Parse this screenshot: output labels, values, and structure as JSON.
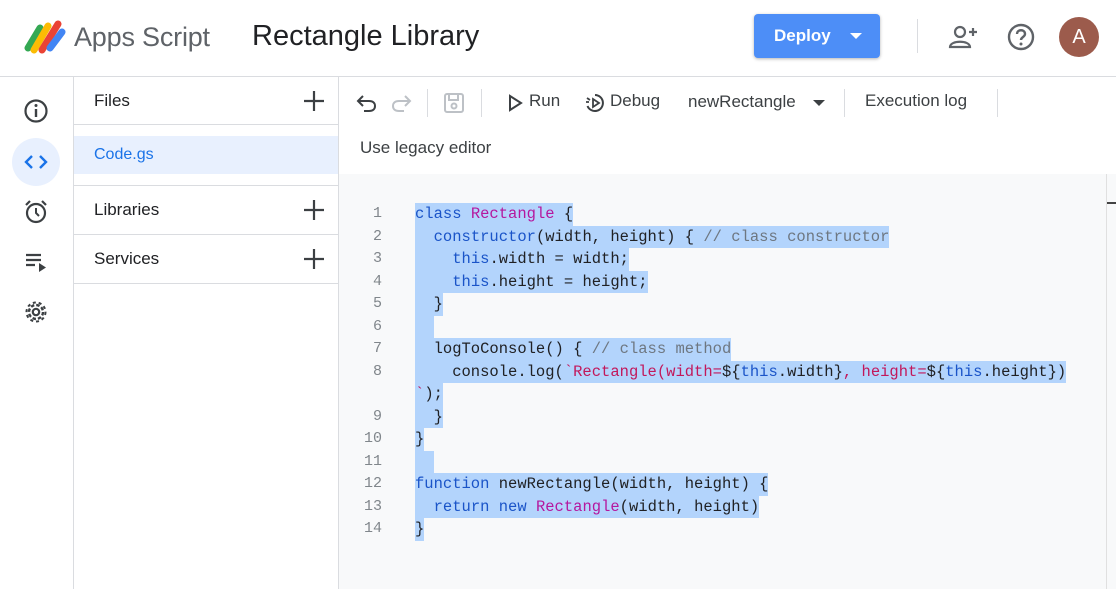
{
  "header": {
    "app_name": "Apps Script",
    "project_title": "Rectangle Library",
    "deploy_label": "Deploy",
    "avatar_initial": "A",
    "accent_color": "#4d8ef7"
  },
  "rail": {
    "items": [
      {
        "name": "overview",
        "icon": "info-icon"
      },
      {
        "name": "editor",
        "icon": "code-icon",
        "active": true
      },
      {
        "name": "triggers",
        "icon": "alarm-clock-icon"
      },
      {
        "name": "executions",
        "icon": "executions-list-icon"
      },
      {
        "name": "settings",
        "icon": "gear-icon"
      }
    ]
  },
  "files_panel": {
    "files_title": "Files",
    "files": [
      "Code.gs"
    ],
    "libraries_title": "Libraries",
    "services_title": "Services"
  },
  "toolbar": {
    "run_label": "Run",
    "debug_label": "Debug",
    "function_selected": "newRectangle",
    "execution_log_label": "Execution log",
    "legacy_label": "Use legacy editor"
  },
  "editor": {
    "line_numbers": [
      "1",
      "2",
      "3",
      "4",
      "5",
      "6",
      "7",
      "8",
      "",
      "9",
      "10",
      "11",
      "12",
      "13",
      "14"
    ],
    "lines": [
      [
        [
          "k",
          "class"
        ],
        [
          "p",
          " "
        ],
        [
          "t",
          "Rectangle"
        ],
        [
          "p",
          " {"
        ]
      ],
      [
        [
          "p",
          "  "
        ],
        [
          "k",
          "constructor"
        ],
        [
          "p",
          "(width, height) { "
        ],
        [
          "cm",
          "// class constructor"
        ]
      ],
      [
        [
          "p",
          "    "
        ],
        [
          "k",
          "this"
        ],
        [
          "p",
          ".width = width;"
        ]
      ],
      [
        [
          "p",
          "    "
        ],
        [
          "k",
          "this"
        ],
        [
          "p",
          ".height = height;"
        ]
      ],
      [
        [
          "p",
          "  }"
        ]
      ],
      [
        [
          "p",
          "  "
        ]
      ],
      [
        [
          "p",
          "  logToConsole() { "
        ],
        [
          "cm",
          "// class method"
        ]
      ],
      [
        [
          "p",
          "    console.log("
        ],
        [
          "s",
          "`Rectangle(width="
        ],
        [
          "p",
          "${"
        ],
        [
          "k",
          "this"
        ],
        [
          "p",
          ".width}"
        ],
        [
          "s",
          ", height="
        ],
        [
          "p",
          "${"
        ],
        [
          "k",
          "this"
        ],
        [
          "p",
          ".height})"
        ]
      ],
      [
        [
          "s",
          "`"
        ],
        [
          "p",
          ");"
        ]
      ],
      [
        [
          "p",
          "  }"
        ]
      ],
      [
        [
          "p",
          "}"
        ]
      ],
      [
        [
          "p",
          "  "
        ]
      ],
      [
        [
          "k",
          "function"
        ],
        [
          "p",
          " newRectangle(width, height) {"
        ]
      ],
      [
        [
          "p",
          "  "
        ],
        [
          "k",
          "return"
        ],
        [
          "p",
          " "
        ],
        [
          "k",
          "new"
        ],
        [
          "p",
          " "
        ],
        [
          "t",
          "Rectangle"
        ],
        [
          "p",
          "(width, height)"
        ]
      ],
      [
        [
          "p",
          "}"
        ]
      ]
    ]
  }
}
